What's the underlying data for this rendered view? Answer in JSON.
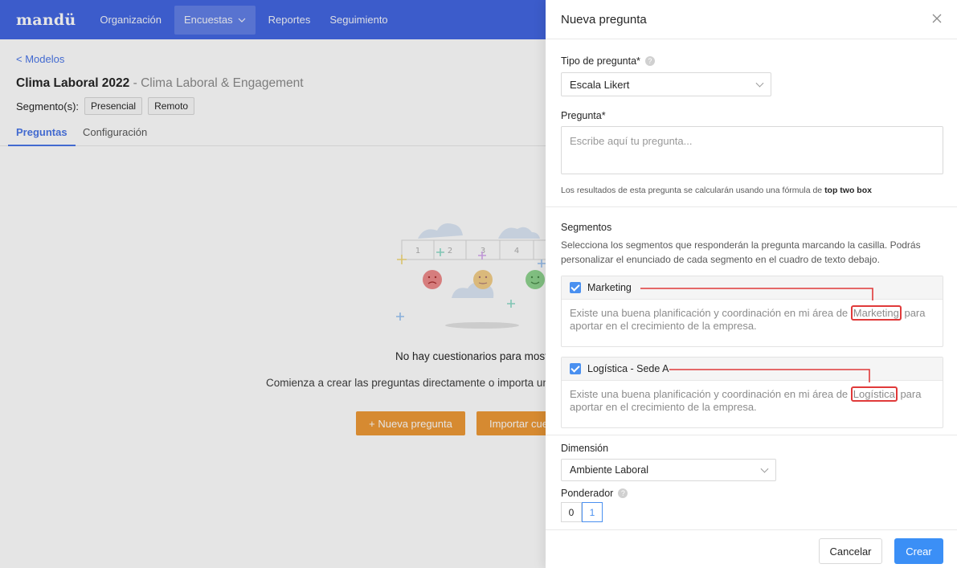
{
  "topnav": {
    "logo": "mandü",
    "items": [
      {
        "label": "Organización"
      },
      {
        "label": "Encuestas"
      },
      {
        "label": "Reportes"
      },
      {
        "label": "Seguimiento"
      }
    ]
  },
  "page": {
    "back_link": "< Modelos",
    "title": "Clima Laboral 2022",
    "title_sep": " - ",
    "subtitle": "Clima Laboral & Engagement",
    "segments_label": "Segmento(s):",
    "segments": [
      "Presencial",
      "Remoto"
    ],
    "tabs": [
      "Preguntas",
      "Configuración"
    ],
    "empty_title": "No hay cuestionarios para most",
    "empty_desc": "Comienza a crear las preguntas directamente o importa un a",
    "btn_new": "+ Nueva pregunta",
    "btn_import": "Importar cue",
    "scale_numbers": [
      "1",
      "2",
      "3",
      "4"
    ]
  },
  "drawer": {
    "title": "Nueva pregunta",
    "type_label": "Tipo de pregunta*",
    "type_value": "Escala Likert",
    "question_label": "Pregunta*",
    "question_placeholder": "Escribe aquí tu pregunta...",
    "hint_prefix": "Los resultados de esta pregunta se calcularán usando una fórmula de ",
    "hint_bold": "top two box",
    "segments_title": "Segmentos",
    "segments_desc": "Selecciona los segmentos que responderán la pregunta marcando la casilla. Podrás personalizar el enunciado de cada segmento en el cuadro de texto debajo.",
    "segment_cards": [
      {
        "name": "Marketing",
        "text_before": "Existe una buena planificación y coordinación en mi área de ",
        "highlight": "Marketing",
        "text_after": " para aportar en el crecimiento de la empresa."
      },
      {
        "name": "Logística - Sede A",
        "text_before": "Existe una buena planificación y coordinación en mi área de ",
        "highlight": "Logística",
        "text_after": " para aportar en el crecimiento de la empresa."
      }
    ],
    "dimension_label": "Dimensión",
    "dimension_value": "Ambiente Laboral",
    "weight_label": "Ponderador",
    "weight_options": [
      "0",
      "1"
    ],
    "weight_selected": "1",
    "cancel": "Cancelar",
    "create": "Crear"
  },
  "colors": {
    "nav": "#4367e3",
    "accent": "#3b8ff6",
    "orange": "#ef9a37",
    "annotation": "#e03a3a"
  }
}
